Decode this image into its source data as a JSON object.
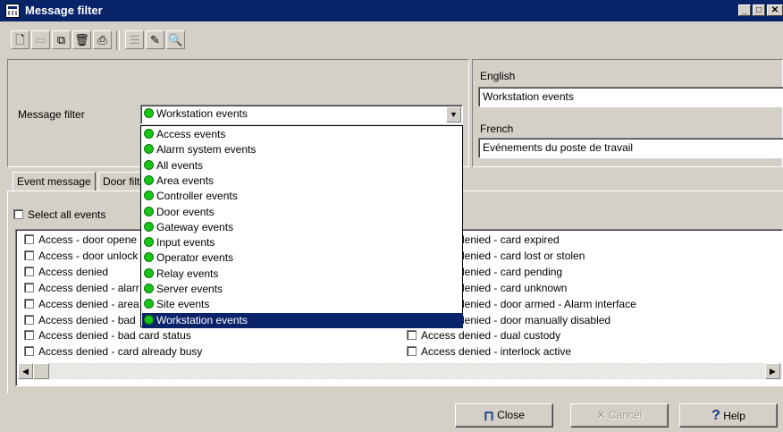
{
  "window": {
    "title": "Message filter"
  },
  "filter": {
    "label": "Message filter",
    "selected": "Workstation events",
    "options": [
      "Access events",
      "Alarm system events",
      "All events",
      "Area events",
      "Controller events",
      "Door events",
      "Gateway events",
      "Input events",
      "Operator events",
      "Relay events",
      "Server events",
      "Site events",
      "Workstation events"
    ]
  },
  "lang": {
    "english_label": "English",
    "english_value": "Workstation events",
    "french_label": "French",
    "french_value": "Evénements du poste de travail"
  },
  "tabs": [
    "Event message",
    "Door filt"
  ],
  "select_all": "Select all events",
  "events_left": [
    "Access - door opene",
    "Access - door unlock",
    "Access denied",
    "Access denied - alarr",
    "Access denied - area",
    "Access denied - bad",
    "Access denied - bad card status",
    "Access denied - card already busy"
  ],
  "events_right": [
    "lenied - card expired",
    "lenied - card lost or stolen",
    "lenied - card pending",
    "lenied - card unknown",
    "lenied - door armed - Alarm interface",
    "lenied - door manually disabled",
    "Access denied - dual custody",
    "Access denied - interlock active"
  ],
  "buttons": {
    "close": "Close",
    "cancel": "Cancel",
    "help": "Help"
  },
  "colors": {
    "titlebar": "#0a246a",
    "face": "#d4d0c8",
    "status_dot": "#17c417",
    "selection": "#0a246a"
  }
}
